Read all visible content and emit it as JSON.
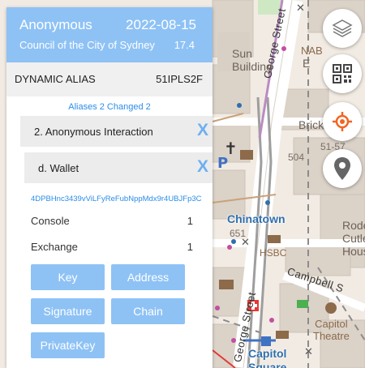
{
  "map": {
    "street_labels": [
      "George Street",
      "Campbell S"
    ],
    "place_labels": {
      "sun_building": "Sun\nBuilding",
      "brickfield": "Brickfield H",
      "chinatown": "Chinatown",
      "hsbc": "HSBC",
      "capitol_theatre": "Capitol\nTheatre",
      "capitol_square": "Capitol\nSquare",
      "rode_cutle_house": "Rode\nCutle\nHous",
      "nab": "NAB",
      "e_label": "E"
    },
    "numbers": [
      "504",
      "51-57",
      "651"
    ]
  },
  "side_controls": [
    {
      "icon": "layers-icon"
    },
    {
      "icon": "qr-code-icon"
    },
    {
      "icon": "locate-icon"
    },
    {
      "icon": "map-pin-icon"
    }
  ],
  "panel": {
    "header": {
      "name": "Anonymous",
      "date": "2022-08-15",
      "council": "Council of the City of Sydney",
      "number": "17.4",
      "color": "#8ec2f5"
    },
    "alias_bar": {
      "label": "DYNAMIC ALIAS",
      "value": "51IPLS2F"
    },
    "aliases_link": "Aliases 2 Changed 2",
    "chips": [
      {
        "label": "2. Anonymous Interaction",
        "close": "X"
      },
      {
        "label": "d. Wallet",
        "close": "X"
      }
    ],
    "address": "4DPBHnc3439vViLFyReFubNppMdx9r4UBJFp3C",
    "stats": [
      {
        "label": "Console",
        "value": "1"
      },
      {
        "label": "Exchange",
        "value": "1"
      }
    ],
    "buttons": [
      "Key",
      "Address",
      "Signature",
      "Chain",
      "PrivateKey"
    ],
    "accent": "#2a8de9"
  }
}
